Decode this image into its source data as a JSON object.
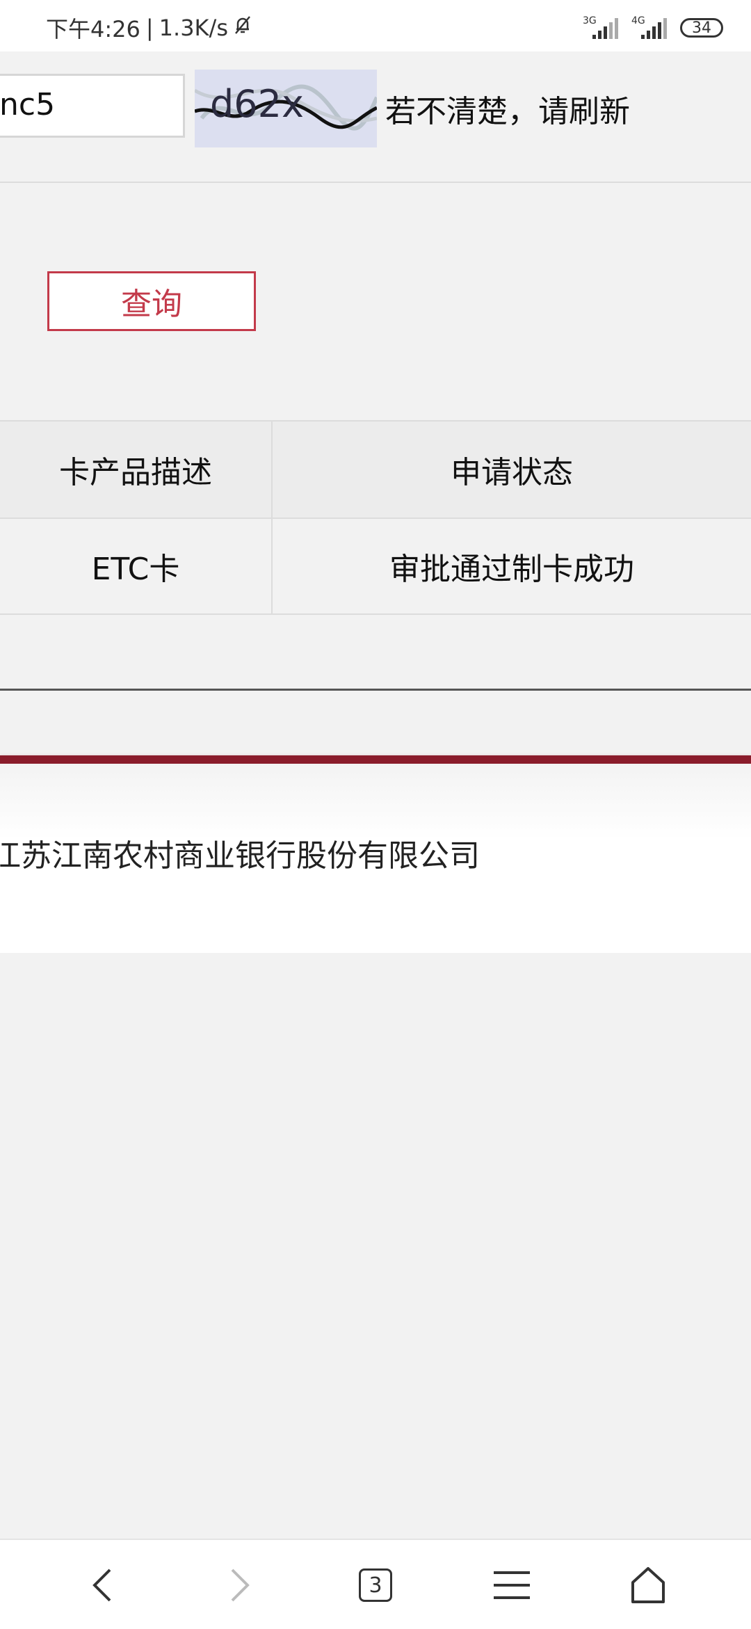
{
  "status_bar": {
    "time": "下午4:26",
    "separator": "|",
    "network_speed": "1.3K/s",
    "mute_icon": "bell-off-icon",
    "sim1_label": "3G",
    "sim2_label": "4G",
    "battery": "34"
  },
  "form": {
    "code_value": "nc5",
    "captcha_text": "d62x",
    "refresh_hint": "若不清楚，请刷新",
    "query_label": "查询"
  },
  "table": {
    "headers": [
      "卡产品描述",
      "申请状态"
    ],
    "rows": [
      [
        "ETC卡",
        "审批通过制卡成功"
      ]
    ]
  },
  "footer": {
    "company": "江苏江南农村商业银行股份有限公司"
  },
  "bottom_nav": {
    "tab_count": "3"
  },
  "colors": {
    "accent": "#c33a4a",
    "footer_bar": "#8a1c2b",
    "page_bg": "#f2f2f2"
  }
}
